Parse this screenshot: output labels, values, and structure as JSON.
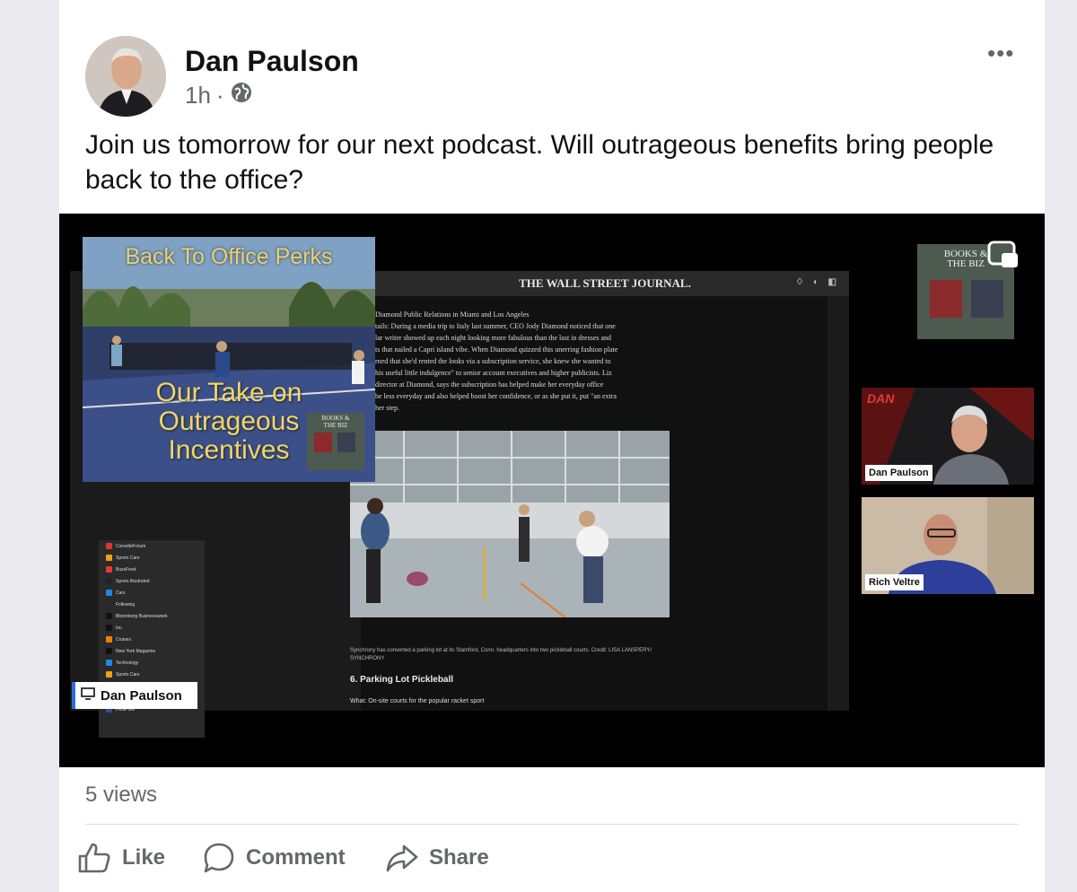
{
  "post": {
    "author": "Dan Paulson",
    "time": "1h",
    "separator": "·",
    "text": "Join us tomorrow for our next podcast. Will outrageous benefits bring people back to the office?",
    "more_label": "•••"
  },
  "video": {
    "thumbnail": {
      "title": "Back To Office Perks",
      "line1": "Our Take on",
      "line2": "Outrageous",
      "line3": "Incentives"
    },
    "article": {
      "masthead": "THE WALL STREET JOURNAL.",
      "lines": [
        "Diamond Public Relations in Miami and Los Angeles",
        "tails: During a media trip to Italy last summer, CEO Jody Diamond noticed that one",
        "lar writer showed up each night looking more fabulous than the last in dresses and",
        "ts that nailed a Capri island vibe. When Diamond quizzed this unerring fashion plate",
        "rned that she'd rented the looks via a subscription service, she knew she wanted to",
        "his useful little indulgence\" to senior account executives and higher publicists. Liz",
        "director at Diamond, says the subscription has helped make her everyday office",
        "be less everyday and also helped boost her confidence, or as she put it, put \"an extra",
        "her step."
      ],
      "caption": "Synchrony has converted a parking lot at its Stamford, Conn. headquarters into two pickleball courts. Credit: LISA LANSPERY/ SYNCHRONY",
      "headline": "6. Parking Lot Pickleball",
      "what": "What: On-site courts for the popular racket sport"
    },
    "sidebar_items": [
      {
        "label": "CorvetteForum",
        "color": "#d33"
      },
      {
        "label": "Sports Cars",
        "color": "#e8a317"
      },
      {
        "label": "BuzzFeed",
        "color": "#e53935"
      },
      {
        "label": "Sports Illustrated",
        "color": "#222"
      },
      {
        "label": "Cars",
        "color": "#1e88e5"
      },
      {
        "label": "Following",
        "color": "#2a2a2a"
      },
      {
        "label": "Bloomberg Businessweek",
        "color": "#111"
      },
      {
        "label": "Inc.",
        "color": "#111"
      },
      {
        "label": "Cruises",
        "color": "#f57c00"
      },
      {
        "label": "New York Magazine",
        "color": "#111"
      },
      {
        "label": "Technology",
        "color": "#1e88e5"
      },
      {
        "label": "Sports Cars",
        "color": "#e8a317"
      },
      {
        "label": "CorvetteForum",
        "color": "#d33"
      },
      {
        "label": "Entertainment",
        "color": "#1e88e5"
      },
      {
        "label": "PetaPixel",
        "color": "#3949ab"
      }
    ],
    "screen_share_tag": "Dan Paulson",
    "logo": {
      "title_line1": "BOOKS &",
      "title_line2": "THE BIZ"
    },
    "thumb_logo": {
      "title_line1": "BOOKS &",
      "title_line2": "THE BIZ"
    },
    "cam1": {
      "name": "Dan Paulson",
      "brand": "DAN"
    },
    "cam2": {
      "name": "Rich Veltre"
    }
  },
  "stats": {
    "views": "5 views"
  },
  "actions": {
    "like": "Like",
    "comment": "Comment",
    "share": "Share"
  },
  "colors": {
    "accent": "#2a6fd6",
    "muted": "#65676b",
    "background": "#ffffff"
  }
}
